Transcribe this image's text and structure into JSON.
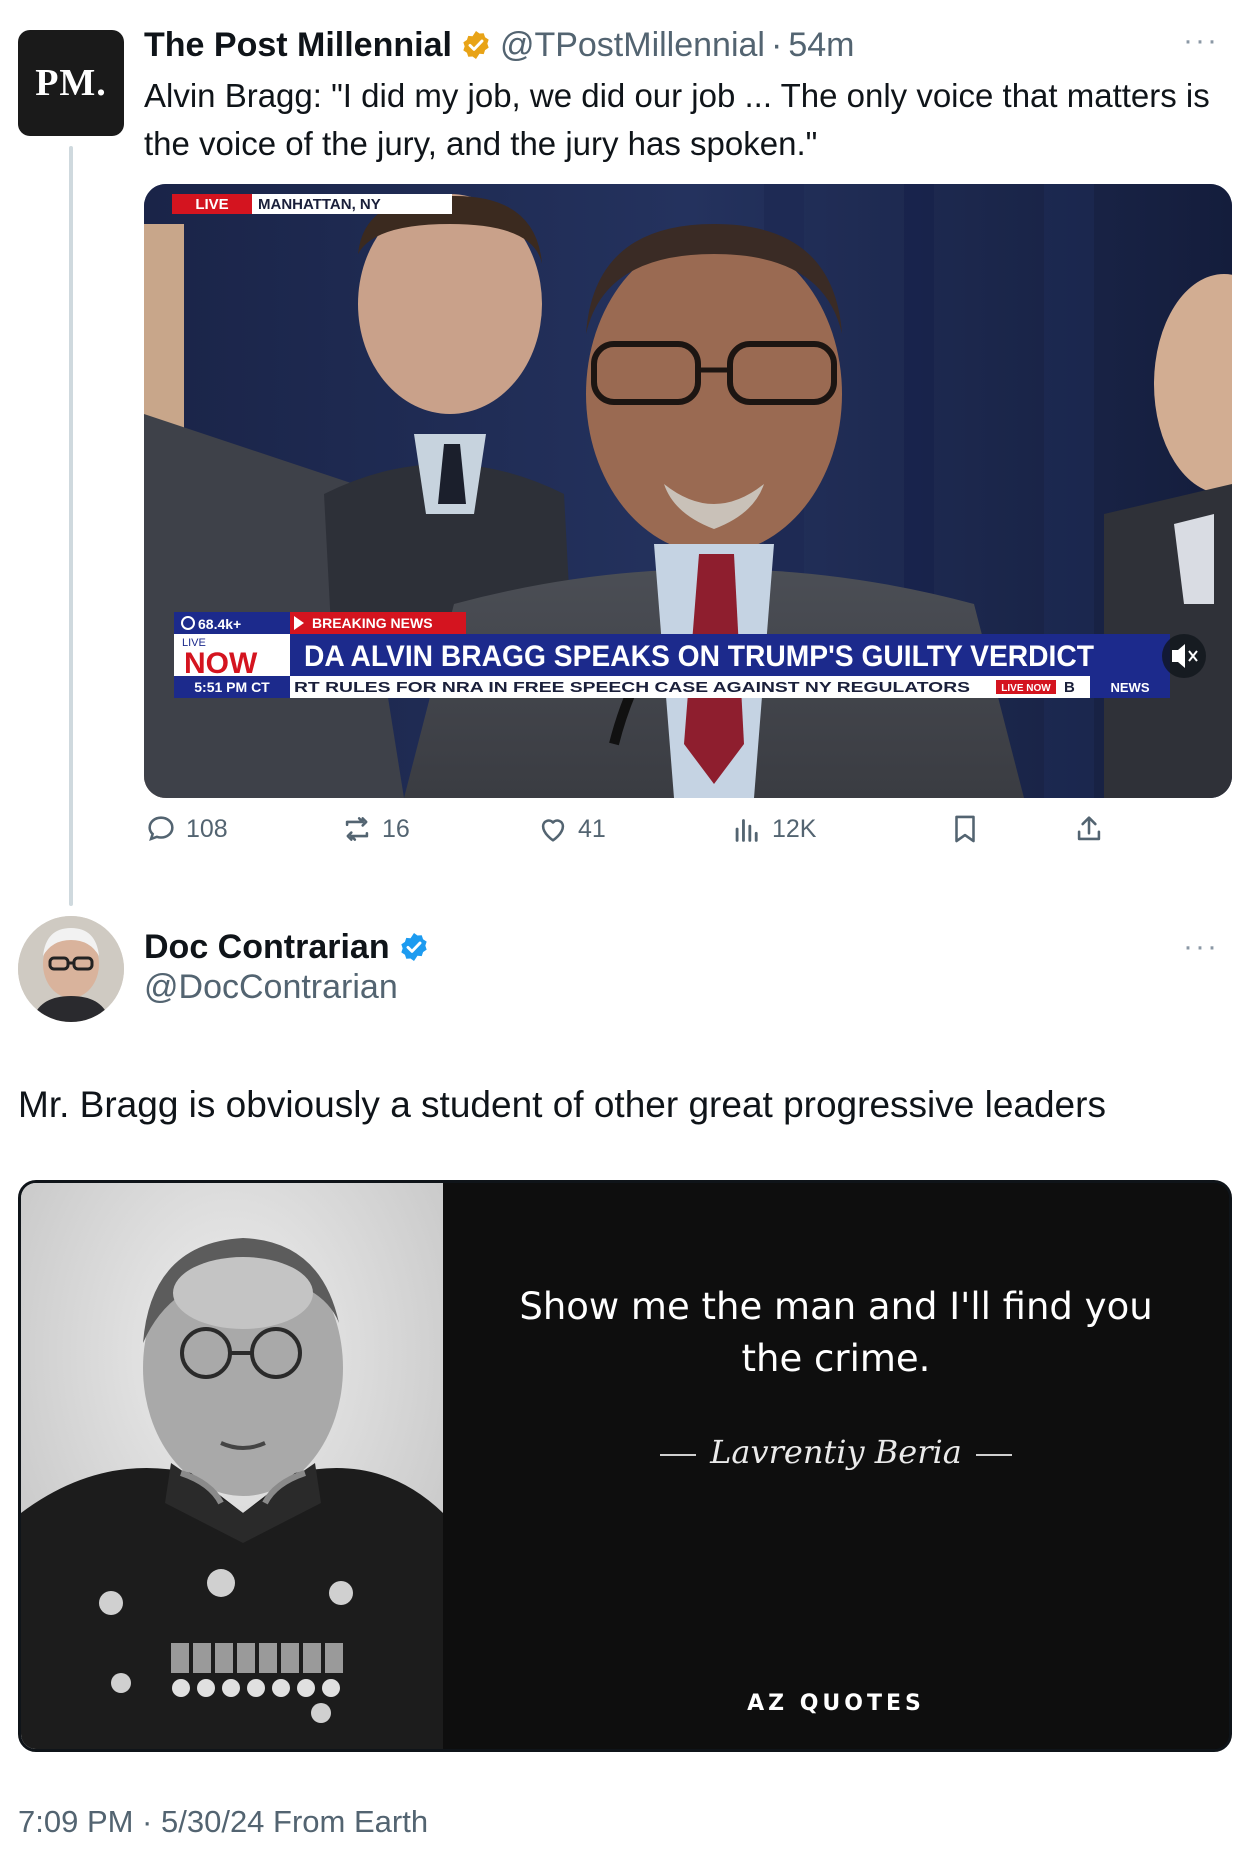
{
  "quoted_tweet": {
    "avatar_text": "PM.",
    "display_name": "The Post Millennial",
    "handle": "@TPostMillennial",
    "separator": "·",
    "time": "54m",
    "more": "···",
    "text": "Alvin Bragg: \"I did my job, we did our job ... The only voice that matters is the voice of the jury, and the jury has spoken.\"",
    "video": {
      "live_tag": "LIVE",
      "location": "MANHATTAN, NY",
      "views": "68.4k+",
      "now_live": "LIVE",
      "now": "NOW",
      "clock": "5:51 PM CT",
      "breaking_label": "BREAKING NEWS",
      "headline": "DA ALVIN BRAGG SPEAKS ON TRUMP'S GUILTY VERDICT",
      "ticker": "RT RULES FOR NRA IN FREE SPEECH CASE AGAINST NY REGULATORS",
      "ticker_logo": "LIVE NOW",
      "ticker_end": "B",
      "network": "NEWS"
    },
    "actions": {
      "replies": "108",
      "reposts": "16",
      "likes": "41",
      "views": "12K"
    },
    "colors": {
      "verified_gold": "#e8a317",
      "breaking_red": "#d4141f",
      "headline_blue": "#1c2a8c"
    }
  },
  "main_tweet": {
    "display_name": "Doc Contrarian",
    "handle": "@DocContrarian",
    "more": "···",
    "text": "Mr. Bragg is obviously a student of other great progressive leaders",
    "image": {
      "quote_line_1": "Show me the man and I'll find you",
      "quote_line_2": "the crime.",
      "author": "Lavrentiy Beria",
      "logo": "AZ QUOTES"
    },
    "timestamp": "7:09 PM · 5/30/24 From Earth",
    "colors": {
      "verified_blue": "#1d9bf0"
    }
  }
}
